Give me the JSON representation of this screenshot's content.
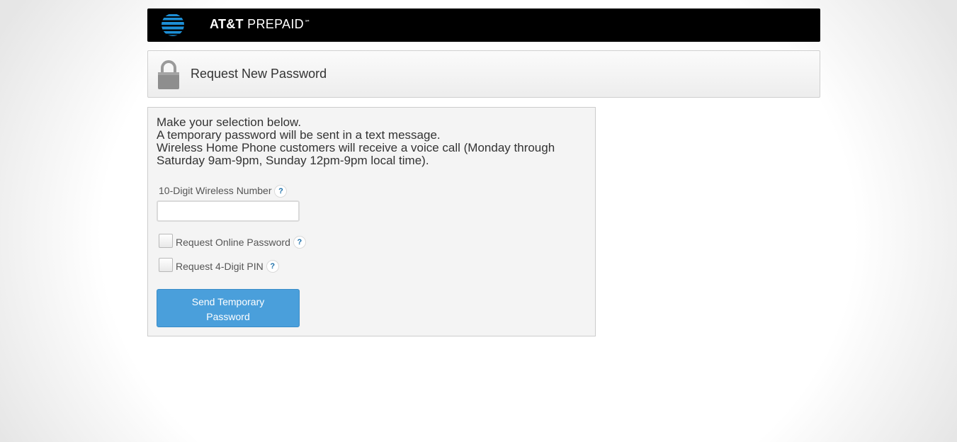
{
  "header": {
    "brand_main": "AT&T",
    "brand_sub": "PREPAID",
    "brand_mark": "℠",
    "logo_icon": "att-globe-icon"
  },
  "title_panel": {
    "icon": "lock-icon",
    "title": "Request New Password"
  },
  "form": {
    "intro_lines": [
      "Make your selection below.",
      "A temporary password will be sent in a text message.",
      "Wireless Home Phone customers will receive a voice call (Monday through",
      "Saturday 9am-9pm, Sunday 12pm-9pm local time)."
    ],
    "phone_label": "10-Digit Wireless Number",
    "phone_value": "",
    "help_glyph": "?",
    "option_online_password": "Request Online Password",
    "option_pin": "Request 4-Digit PIN",
    "submit_label": "Send Temporary Password"
  },
  "colors": {
    "header_bg": "#000000",
    "button_bg": "#4a9fdb",
    "help_text": "#1a6ea8",
    "globe_blue": "#1d8fd6"
  }
}
